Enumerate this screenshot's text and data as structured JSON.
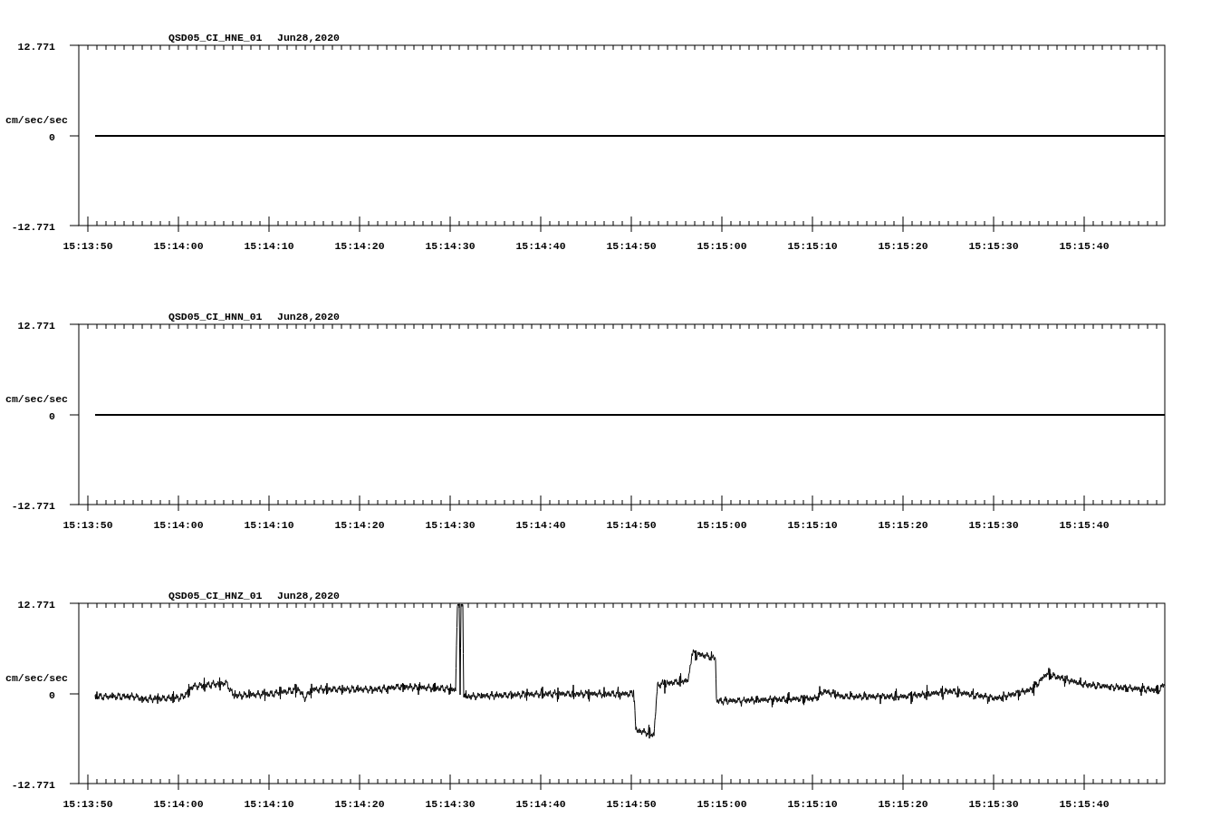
{
  "panels": [
    {
      "title": "QSD05_CI_HNE_01",
      "date": "Jun28,2020",
      "ylabel": "cm/sec/sec",
      "yticks": [
        "12.771",
        "0",
        "-12.771"
      ],
      "xticks": [
        "15:13:50",
        "15:14:00",
        "15:14:10",
        "15:14:20",
        "15:14:30",
        "15:14:40",
        "15:14:50",
        "15:15:00",
        "15:15:10",
        "15:15:20",
        "15:15:30",
        "15:15:40"
      ],
      "trace": {
        "kind": "flat"
      }
    },
    {
      "title": "QSD05_CI_HNN_01",
      "date": "Jun28,2020",
      "ylabel": "cm/sec/sec",
      "yticks": [
        "12.771",
        "0",
        "-12.771"
      ],
      "xticks": [
        "15:13:50",
        "15:14:00",
        "15:14:10",
        "15:14:20",
        "15:14:30",
        "15:14:40",
        "15:14:50",
        "15:15:00",
        "15:15:10",
        "15:15:20",
        "15:15:30",
        "15:15:40"
      ],
      "trace": {
        "kind": "flat"
      }
    },
    {
      "title": "QSD05_CI_HNZ_01",
      "date": "Jun28,2020",
      "ylabel": "cm/sec/sec",
      "yticks": [
        "12.771",
        "0",
        "-12.771"
      ],
      "xticks": [
        "15:13:50",
        "15:14:00",
        "15:14:10",
        "15:14:20",
        "15:14:30",
        "15:14:40",
        "15:14:50",
        "15:15:00",
        "15:15:10",
        "15:15:20",
        "15:15:30",
        "15:15:40"
      ],
      "trace": {
        "kind": "waveform"
      }
    }
  ]
}
